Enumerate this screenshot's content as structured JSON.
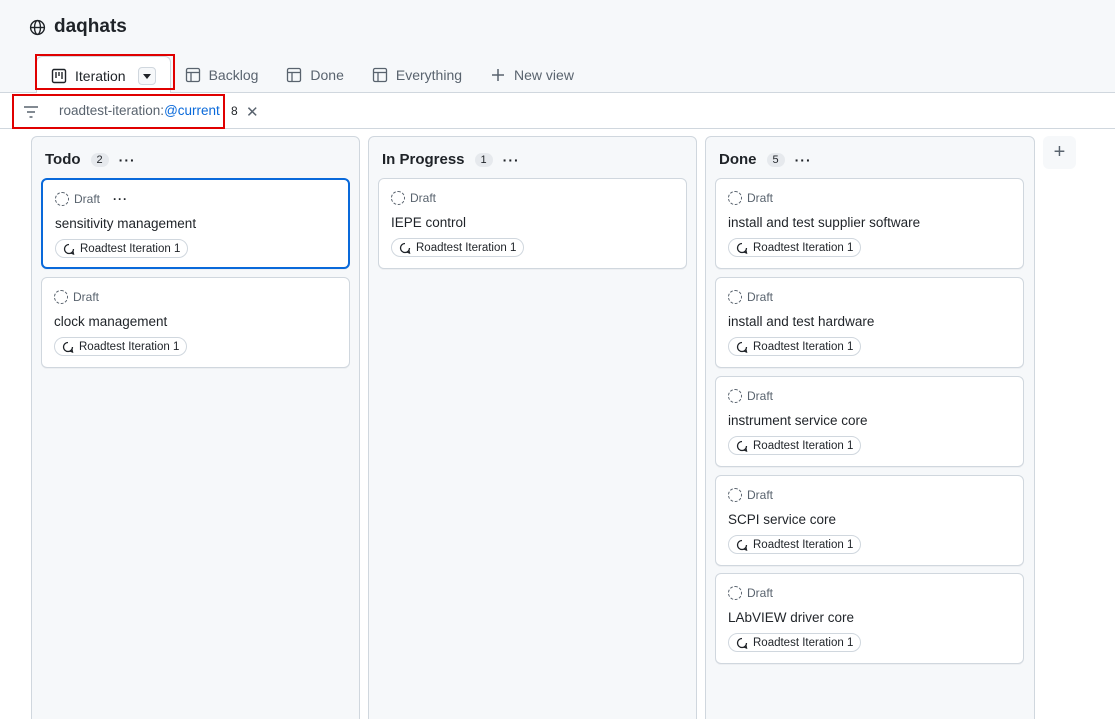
{
  "project": {
    "name": "daqhats"
  },
  "tabs": [
    {
      "label": "Iteration"
    },
    {
      "label": "Backlog"
    },
    {
      "label": "Done"
    },
    {
      "label": "Everything"
    },
    {
      "label": "New view"
    }
  ],
  "filter": {
    "key": "roadtest-iteration:",
    "value": "@current",
    "count": "8",
    "clear": "✕"
  },
  "columns": [
    {
      "title": "Todo",
      "count": "2",
      "menu": "···",
      "cards": [
        {
          "status": "Draft",
          "menu": "···",
          "title": "sensitivity management",
          "iteration": "Roadtest Iteration 1"
        },
        {
          "status": "Draft",
          "title": "clock management",
          "iteration": "Roadtest Iteration 1"
        }
      ]
    },
    {
      "title": "In Progress",
      "count": "1",
      "menu": "···",
      "cards": [
        {
          "status": "Draft",
          "title": "IEPE control",
          "iteration": "Roadtest Iteration 1"
        }
      ]
    },
    {
      "title": "Done",
      "count": "5",
      "menu": "···",
      "cards": [
        {
          "status": "Draft",
          "title": "install and test supplier software",
          "iteration": "Roadtest Iteration 1"
        },
        {
          "status": "Draft",
          "title": "install and test hardware",
          "iteration": "Roadtest Iteration 1"
        },
        {
          "status": "Draft",
          "title": "instrument service core",
          "iteration": "Roadtest Iteration 1"
        },
        {
          "status": "Draft",
          "title": "SCPI service core",
          "iteration": "Roadtest Iteration 1"
        },
        {
          "status": "Draft",
          "title": "LAbVIEW driver core",
          "iteration": "Roadtest Iteration 1"
        }
      ]
    }
  ],
  "add_column": {
    "label": "+"
  },
  "colors": {
    "accent": "#0969da",
    "highlight": "#e00000",
    "border": "#d0d7de"
  }
}
